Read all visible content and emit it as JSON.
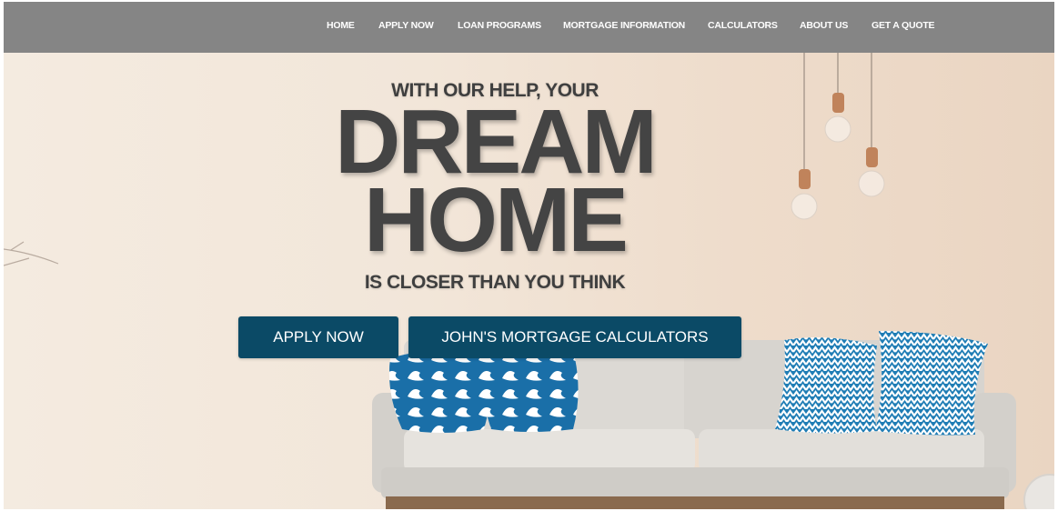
{
  "nav": {
    "items": [
      {
        "label": "HOME"
      },
      {
        "label": "APPLY NOW"
      },
      {
        "label": "LOAN PROGRAMS"
      },
      {
        "label": "MORTGAGE INFORMATION"
      },
      {
        "label": "CALCULATORS"
      },
      {
        "label": "ABOUT US"
      },
      {
        "label": "GET A QUOTE"
      }
    ]
  },
  "hero": {
    "line_top": "WITH OUR HELP, YOUR",
    "line_big_1": "DREAM",
    "line_big_2": "HOME",
    "line_bottom": "IS CLOSER THAN YOU THINK",
    "cta_apply": "APPLY NOW",
    "cta_calc": "JOHN'S MORTGAGE CALCULATORS"
  },
  "colors": {
    "nav_bg": "#858585",
    "button_bg": "#0b4a66",
    "headline": "#444444",
    "pillow_blue": "#1f7db5"
  }
}
